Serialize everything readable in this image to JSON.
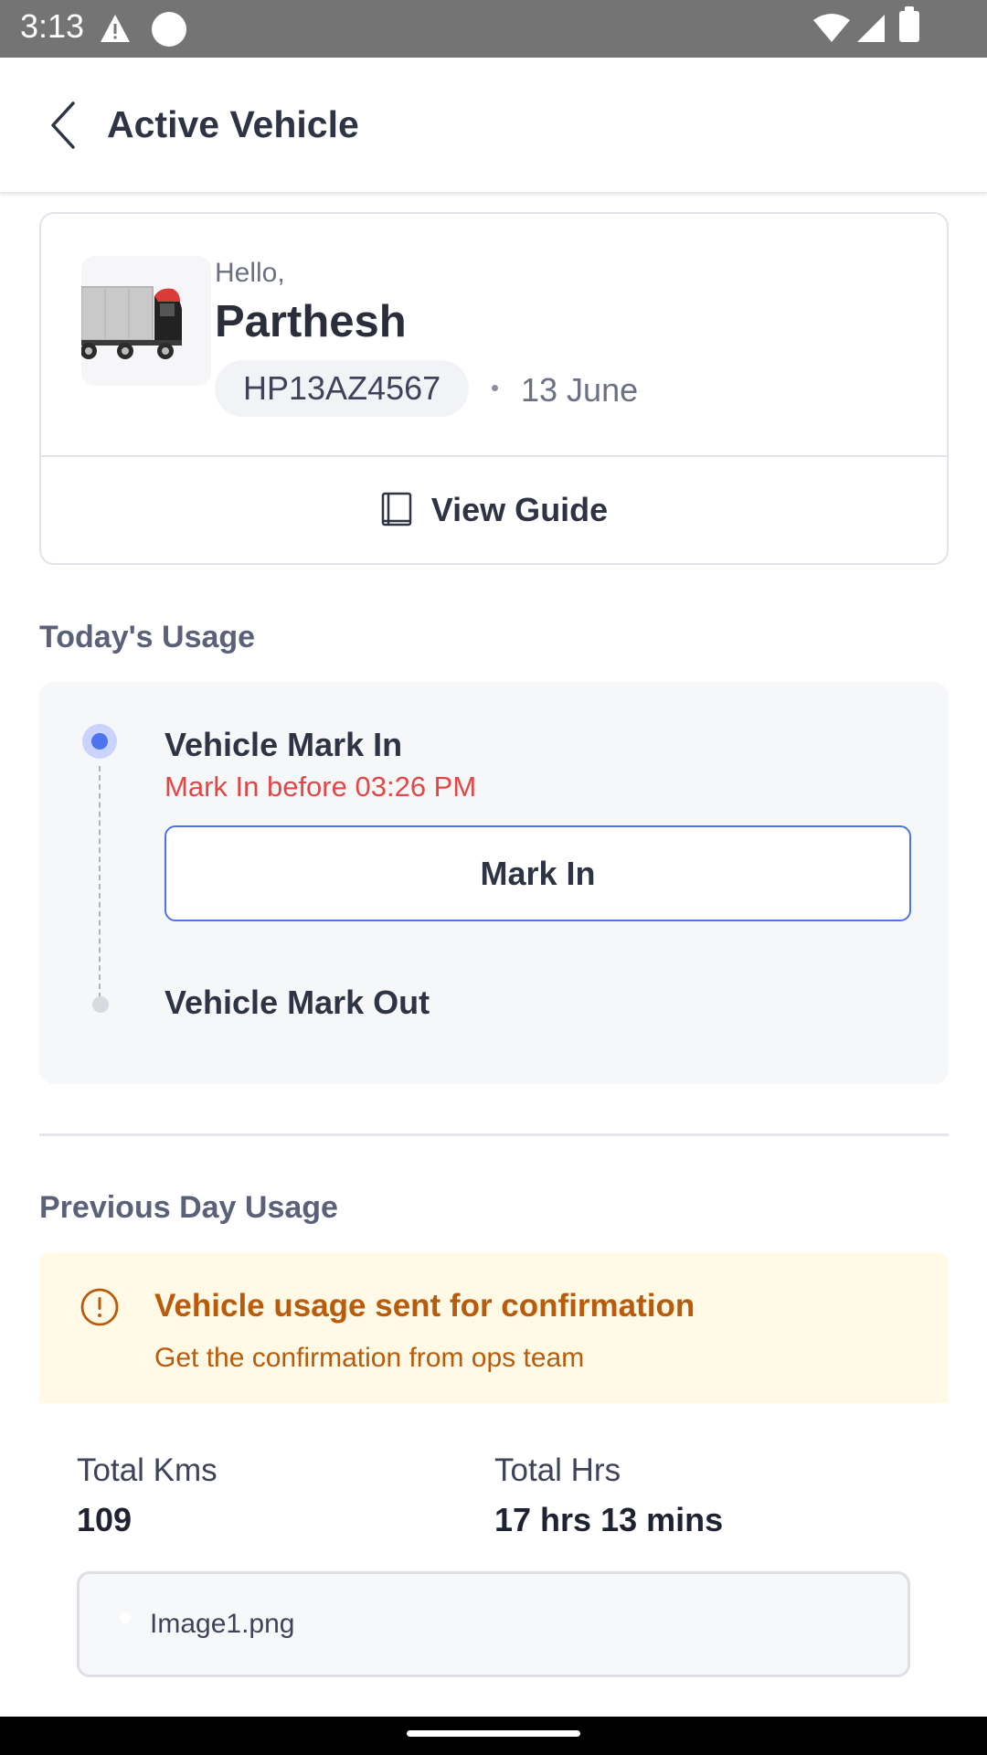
{
  "status_bar": {
    "time": "3:13",
    "icons": [
      "warning-icon",
      "circle-icon",
      "wifi-icon",
      "signal-icon",
      "battery-icon"
    ]
  },
  "header": {
    "title": "Active Vehicle",
    "back_icon": "chevron-left-icon"
  },
  "profile": {
    "greeting": "Hello,",
    "name": "Parthesh",
    "vehicle_number": "HP13AZ4567",
    "date": "13 June",
    "vehicle_icon": "truck-icon",
    "guide_icon": "book-icon",
    "view_guide_label": "View Guide"
  },
  "today_usage": {
    "title": "Today's Usage",
    "mark_in_title": "Vehicle Mark In",
    "mark_in_warning": "Mark In before 03:26 PM",
    "mark_in_button": "Mark In",
    "mark_out_title": "Vehicle Mark Out"
  },
  "previous_usage": {
    "title": "Previous Day Usage",
    "banner_icon": "alert-circle-icon",
    "banner_title": "Vehicle usage sent for confirmation",
    "banner_subtitle": "Get the confirmation from ops team",
    "total_kms_label": "Total Kms",
    "total_kms_value": "109",
    "total_hrs_label": "Total Hrs",
    "total_hrs_value": "17 hrs 13 mins",
    "attachment_name": "Image1.png"
  },
  "colors": {
    "accent": "#4d73ee",
    "warning_text": "#e04848",
    "banner_bg": "#fff9e5",
    "banner_text": "#b85c0b"
  }
}
